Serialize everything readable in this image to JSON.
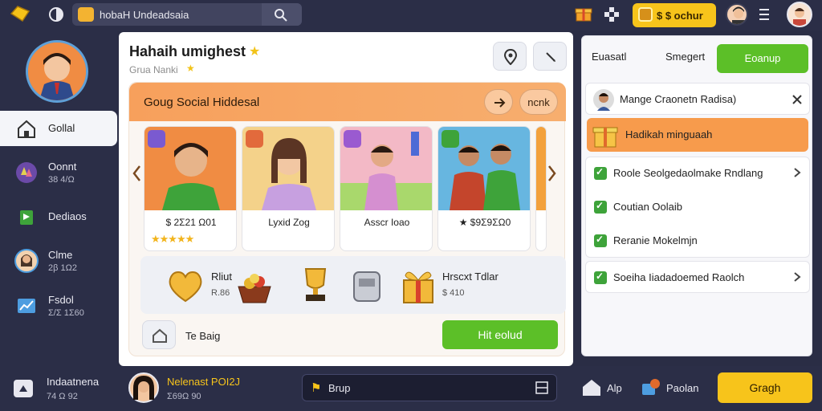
{
  "topbar": {
    "search_text": "hobaH Undeadsaia",
    "coins": "$ $ ochur"
  },
  "sidebar": {
    "items": [
      {
        "label": "Gollal",
        "sub": ""
      },
      {
        "label": "Oonnt",
        "sub": "38 4/Ω"
      },
      {
        "label": "Dediaos",
        "sub": ""
      },
      {
        "label": "Clme",
        "sub": "2β 1Ω2"
      },
      {
        "label": "Fsdol",
        "sub": "Σ/Σ 1Σ60"
      }
    ]
  },
  "main": {
    "title": "Hahaih umighest",
    "subtitle": "Grua Nanki",
    "card_title": "Goug Social Hiddesal",
    "head_btn2": "ncnk",
    "users": [
      {
        "name": "$ 2Σ21 Ω01",
        "stars": "★★★★★"
      },
      {
        "name": "Lyxid Zog",
        "stars": ""
      },
      {
        "name": "Asscr Ioao",
        "stars": ""
      },
      {
        "name": "★ $9Σ9ΣΩ0",
        "stars": ""
      }
    ],
    "gift_title1": "Rliut",
    "gift_sub1": "R.86",
    "gift_title2": "Hrscxt Tdlar",
    "gift_sub2": "$ 410",
    "bottom_label": "Te Baig",
    "action_button": "Hit eolud"
  },
  "right": {
    "tab1": "Euasatl",
    "tab2": "Smegert",
    "button": "Eoanup",
    "user_row": "Mange Craonetn Radisa)",
    "orange_row": "Hadikah minguaah",
    "rows": [
      "Roole Seolgedaolmake Rndlang",
      "Coutian Oolaib",
      "Reranie Mokelmjn",
      "Soeiha Iiadadoemed Raolch"
    ]
  },
  "bottombar": {
    "user1_name": "Indaatnena",
    "user1_sub": "74 Ω 92",
    "user2_name": "Nelenast POI2J",
    "user2_sub": "Σ69Ω 90",
    "search_text": "Brup",
    "nav1": "Alp",
    "nav2": "Paolan",
    "button": "Gragh"
  },
  "colors": {
    "accent_green": "#5cbf28",
    "accent_orange": "#f79b4c",
    "accent_yellow": "#f7c41b",
    "dark_bg": "#2b2e47"
  }
}
